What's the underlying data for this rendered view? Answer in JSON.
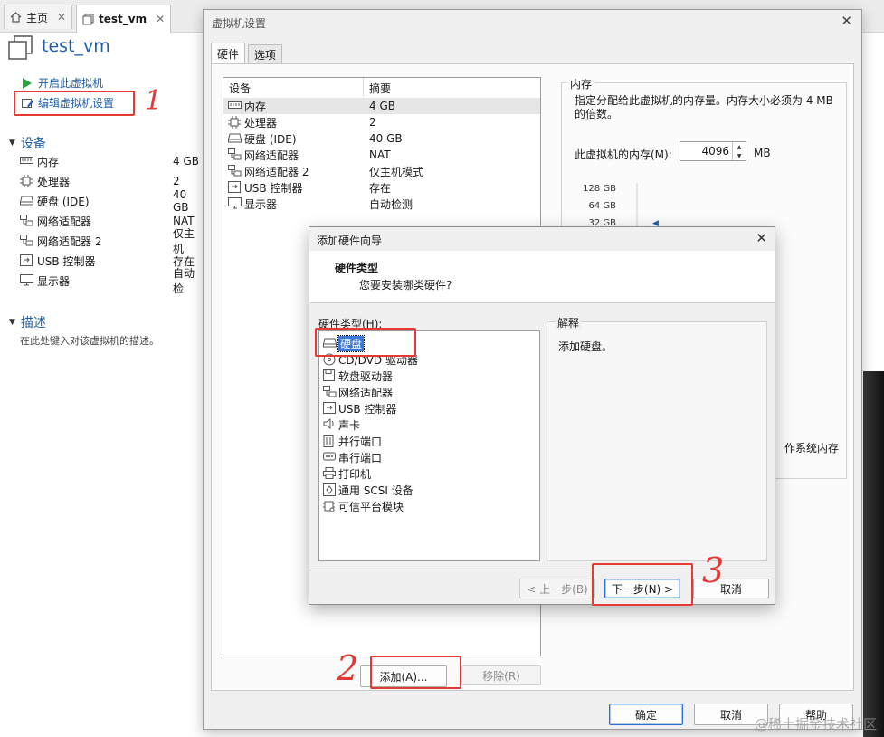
{
  "tabs": [
    {
      "label": "主页",
      "icon": "home-icon"
    },
    {
      "label": "test_vm",
      "icon": "vm-icon",
      "active": true
    }
  ],
  "vm": {
    "name": "test_vm",
    "actions": {
      "power_on": "开启此虚拟机",
      "edit_settings": "编辑虚拟机设置"
    },
    "devices_header": "设备",
    "devices": [
      {
        "name": "内存",
        "value": "4 GB",
        "icon": "memory-icon"
      },
      {
        "name": "处理器",
        "value": "2",
        "icon": "cpu-icon"
      },
      {
        "name": "硬盘 (IDE)",
        "value": "40 GB",
        "icon": "harddisk-icon"
      },
      {
        "name": "网络适配器",
        "value": "NAT",
        "icon": "network-icon"
      },
      {
        "name": "网络适配器 2",
        "value": "仅主机",
        "icon": "network-icon"
      },
      {
        "name": "USB 控制器",
        "value": "存在",
        "icon": "usb-icon"
      },
      {
        "name": "显示器",
        "value": "自动检",
        "icon": "monitor-icon"
      }
    ],
    "desc_header": "描述",
    "desc_placeholder": "在此处键入对该虚拟机的描述。"
  },
  "settings": {
    "title": "虚拟机设置",
    "tabs": [
      "硬件",
      "选项"
    ],
    "list_headers": {
      "device": "设备",
      "summary": "摘要"
    },
    "devices": [
      {
        "name": "内存",
        "summary": "4 GB",
        "icon": "memory-icon",
        "selected": true
      },
      {
        "name": "处理器",
        "summary": "2",
        "icon": "cpu-icon"
      },
      {
        "name": "硬盘 (IDE)",
        "summary": "40 GB",
        "icon": "harddisk-icon"
      },
      {
        "name": "网络适配器",
        "summary": "NAT",
        "icon": "network-icon"
      },
      {
        "name": "网络适配器 2",
        "summary": "仅主机模式",
        "icon": "network-icon"
      },
      {
        "name": "USB 控制器",
        "summary": "存在",
        "icon": "usb-icon"
      },
      {
        "name": "显示器",
        "summary": "自动检测",
        "icon": "monitor-icon"
      }
    ],
    "memory": {
      "group_label": "内存",
      "description": "指定分配给此虚拟机的内存量。内存大小必须为 4 MB 的倍数。",
      "field_label": "此虚拟机的内存(M):",
      "value": "4096",
      "unit": "MB",
      "ticks": [
        "128 GB",
        "64 GB",
        "32 GB"
      ],
      "side_text": "作系统内存"
    },
    "buttons": {
      "add": "添加(A)...",
      "remove": "移除(R)",
      "ok": "确定",
      "cancel": "取消",
      "help": "帮助"
    }
  },
  "wizard": {
    "title": "添加硬件向导",
    "heading": "硬件类型",
    "subheading": "您要安装哪类硬件?",
    "list_label": "硬件类型(H):",
    "hardware_types": [
      {
        "label": "硬盘",
        "icon": "harddisk-icon",
        "selected": true
      },
      {
        "label": "CD/DVD 驱动器",
        "icon": "cd-icon"
      },
      {
        "label": "软盘驱动器",
        "icon": "floppy-icon"
      },
      {
        "label": "网络适配器",
        "icon": "network-icon"
      },
      {
        "label": "USB 控制器",
        "icon": "usb-icon"
      },
      {
        "label": "声卡",
        "icon": "sound-icon"
      },
      {
        "label": "并行端口",
        "icon": "parallel-port-icon"
      },
      {
        "label": "串行端口",
        "icon": "serial-port-icon"
      },
      {
        "label": "打印机",
        "icon": "printer-icon"
      },
      {
        "label": "通用 SCSI 设备",
        "icon": "scsi-icon"
      },
      {
        "label": "可信平台模块",
        "icon": "tpm-icon"
      }
    ],
    "explanation_label": "解释",
    "explanation_text": "添加硬盘。",
    "buttons": {
      "back": "< 上一步(B)",
      "next": "下一步(N) >",
      "cancel": "取消"
    }
  },
  "annotations": {
    "step1": "1",
    "step2": "2",
    "step3": "3"
  },
  "watermark": "@稀土掘金技术社区",
  "colors": {
    "accent_blue": "#1f5faa",
    "annotation_red": "#e53935",
    "selection_blue": "#3c78d8"
  }
}
